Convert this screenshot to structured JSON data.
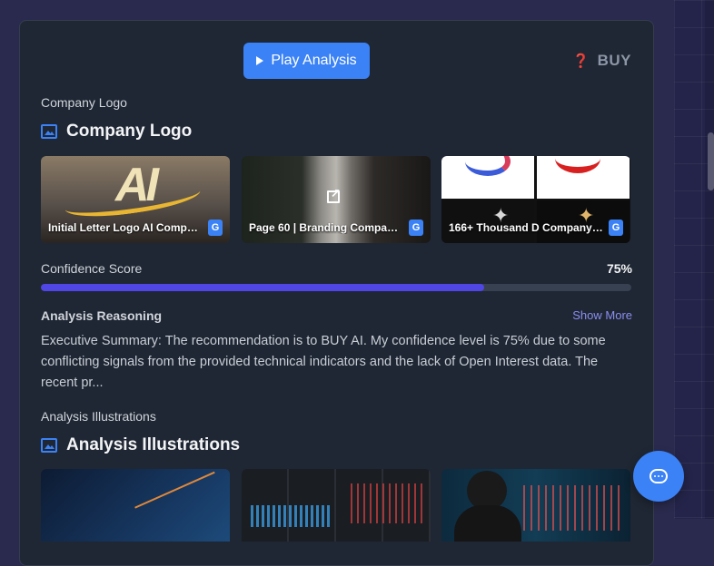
{
  "header": {
    "play_label": "Play Analysis",
    "recommendation_icon": "❓",
    "recommendation": "BUY"
  },
  "logo_section": {
    "label": "Company Logo",
    "title": "Company Logo",
    "images": [
      {
        "caption": "Initial Letter Logo AI Company...",
        "source_badge": "G"
      },
      {
        "caption": "Page 60 | Branding Company...",
        "source_badge": "G"
      },
      {
        "caption": "166+ Thousand D Company ...",
        "source_badge": "G"
      }
    ]
  },
  "confidence": {
    "label": "Confidence Score",
    "value_text": "75%",
    "value": 0.75
  },
  "reasoning": {
    "label": "Analysis Reasoning",
    "show_more": "Show More",
    "text": "Executive Summary: The recommendation is to BUY AI. My confidence level is 75% due to some conflicting signals from the provided technical indicators and the lack of Open Interest data. The recent pr..."
  },
  "illustrations_section": {
    "label": "Analysis Illustrations",
    "title": "Analysis Illustrations"
  },
  "colors": {
    "accent": "#3b82f6",
    "progress": "#4f46e5",
    "card_bg": "#1f2734"
  }
}
